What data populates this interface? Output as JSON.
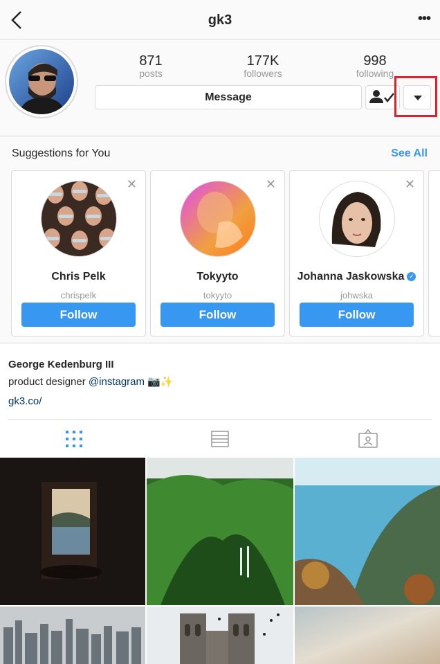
{
  "header": {
    "title": "gk3",
    "back_icon": "chevron-left-icon",
    "more_icon": "ellipsis-icon",
    "more_label": "•••"
  },
  "profile": {
    "stats": [
      {
        "value": "871",
        "label": "posts"
      },
      {
        "value": "177K",
        "label": "followers"
      },
      {
        "value": "998",
        "label": "following"
      }
    ],
    "message_label": "Message",
    "following_icon": "person-check-icon",
    "dropdown_icon": "caret-down-icon"
  },
  "suggestions": {
    "title": "Suggestions for You",
    "see_all": "See All",
    "cards": [
      {
        "name": "Chris Pelk",
        "handle": "chrispelk",
        "follow": "Follow",
        "close": "✕"
      },
      {
        "name": "Tokyyto",
        "handle": "tokyyto",
        "follow": "Follow",
        "close": "✕"
      },
      {
        "name": "Johanna Jaskowska",
        "handle": "johwska",
        "follow": "Follow",
        "close": "✕",
        "verified": true
      }
    ]
  },
  "bio": {
    "full_name": "George Kedenburg III",
    "description": "product designer",
    "mention": "@instagram",
    "emoji": "📷✨",
    "website": "gk3.co/"
  },
  "tabs": [
    {
      "icon": "grid-icon",
      "active": true
    },
    {
      "icon": "list-icon",
      "active": false
    },
    {
      "icon": "tagged-icon",
      "active": false
    }
  ],
  "colors": {
    "accent": "#3897f0",
    "highlight": "#e0202a",
    "link": "#003569"
  }
}
